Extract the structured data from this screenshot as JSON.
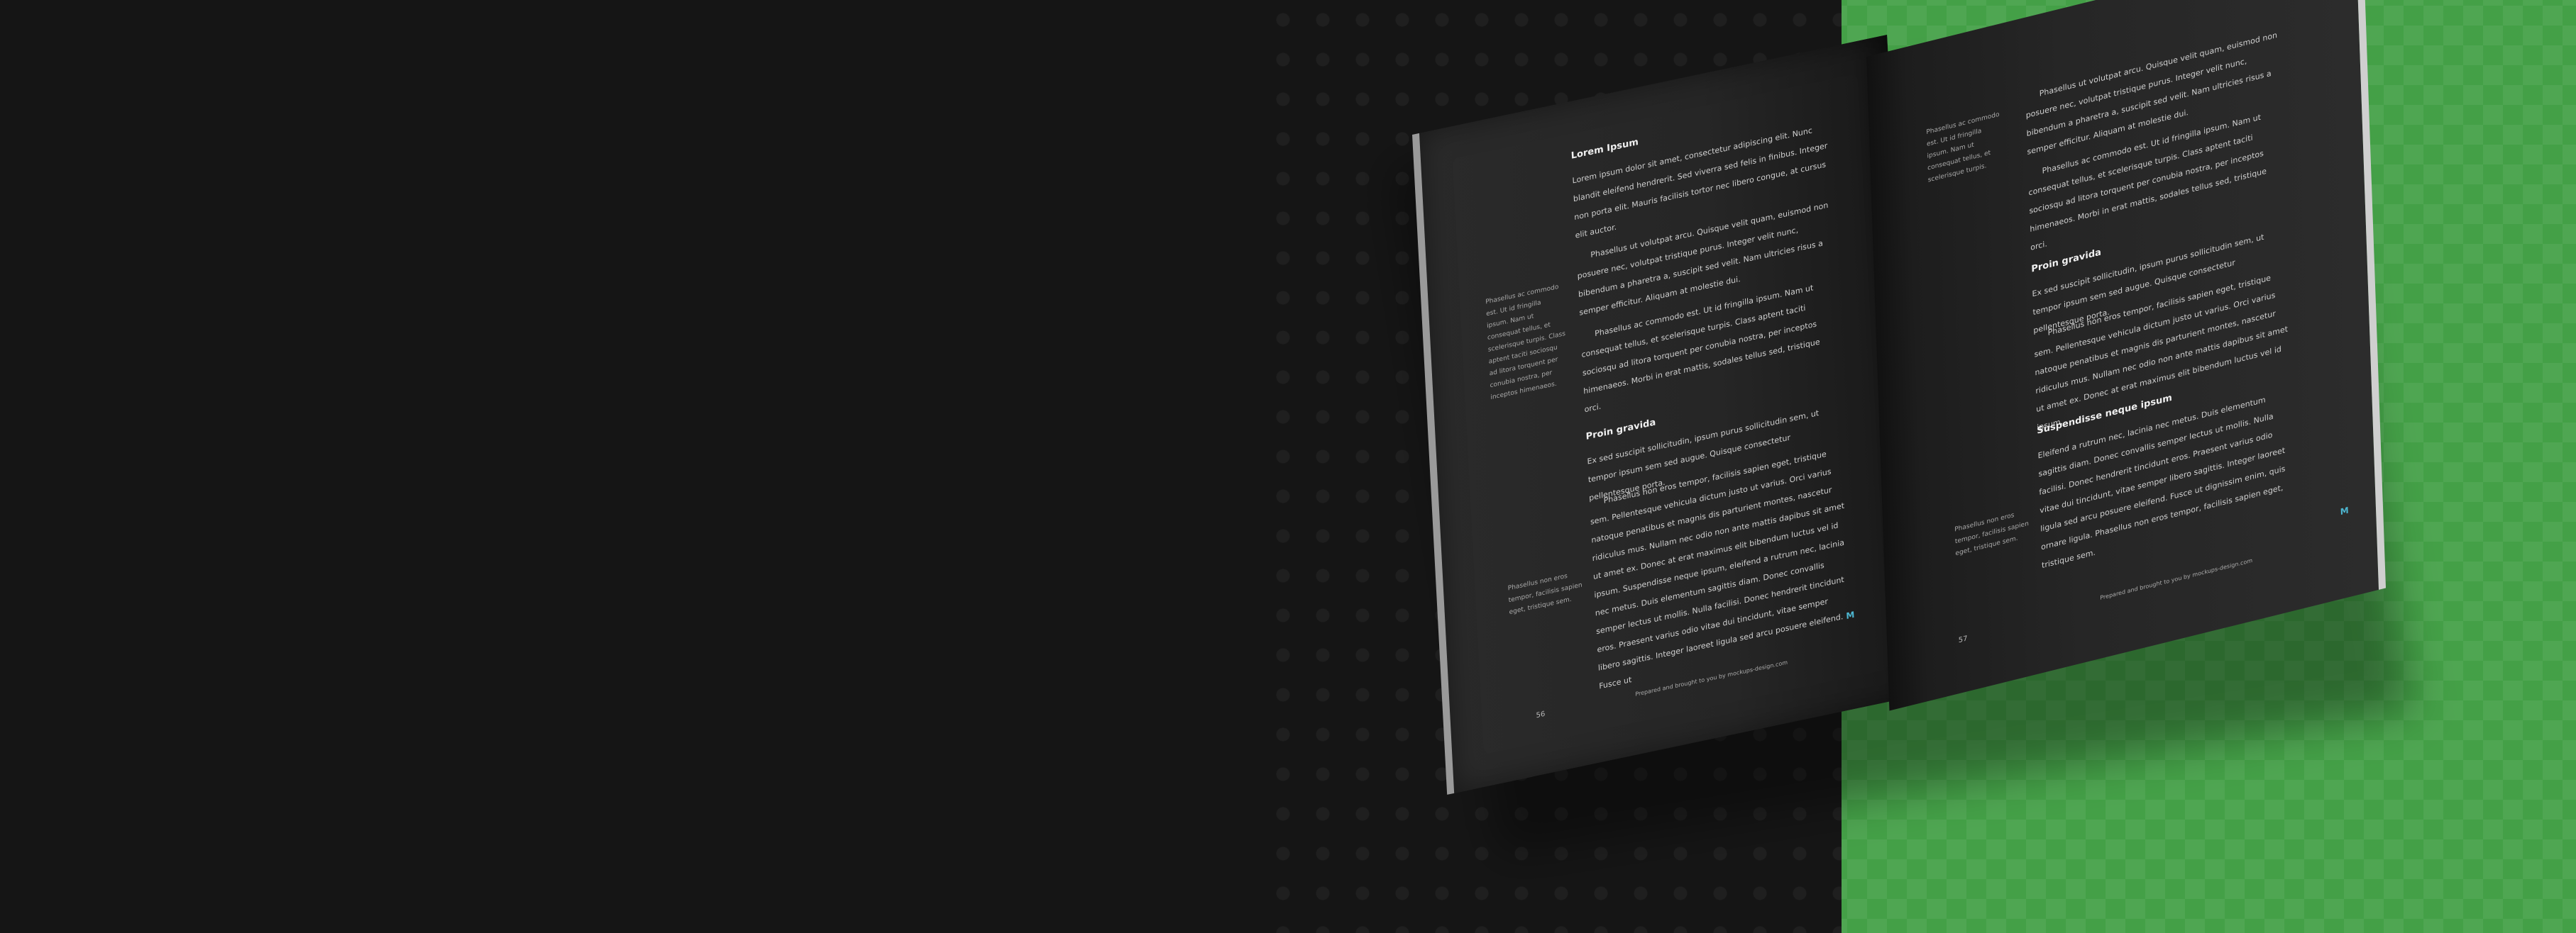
{
  "colors": {
    "dark_bg": "#151515",
    "green_bg": "#44a047",
    "accent": "#4db6d0"
  },
  "left_page": {
    "heading1": "Lorem Ipsum",
    "para1": "Lorem ipsum dolor sit amet, consectetur adipiscing elit. Nunc blandit eleifend hendrerit. Sed viverra sed felis in finibus. Integer non porta elit. Mauris facilisis tortor nec libero congue, at cursus elit auctor.",
    "para2": "Phasellus ut volutpat arcu. Quisque velit quam, euismod non posuere nec, volutpat tristique purus. Integer velit nunc, bibendum a pharetra a, suscipit sed velit. Nam ultricies risus a semper efficitur. Aliquam at molestie dui.",
    "para3": "Phasellus ac commodo est. Ut id fringilla ipsum. Nam ut consequat tellus, et scelerisque turpis. Class aptent taciti sociosqu ad litora torquent per conubia nostra, per inceptos himenaeos. Morbi in erat mattis, sodales tellus sed, tristique orci.",
    "sidenote1": "Phasellus ac commodo est. Ut id fringilla ipsum. Nam ut consequat tellus, et scelerisque turpis. Class aptent taciti sociosqu ad litora torquent per conubia nostra, per inceptos himenaeos.",
    "heading2": "Proin gravida",
    "para4": "Ex sed suscipit sollicitudin, ipsum purus sollicitudin sem, ut tempor ipsum sem sed augue. Quisque consectetur pellentesque porta.",
    "para5": "Phasellus non eros tempor, facilisis sapien eget, tristique sem. Pellentesque vehicula dictum justo ut varius. Orci varius natoque penatibus et magnis dis parturient montes, nascetur ridiculus mus. Nullam nec odio non ante mattis dapibus sit amet ut amet ex. Donec at erat maximus elit bibendum luctus vel id ipsum. Suspendisse neque ipsum, eleifend a rutrum nec, lacinia nec metus. Duis elementum sagittis diam. Donec convallis semper lectus ut mollis. Nulla facilisi. Donec hendrerit tincidunt eros. Praesent varius odio vitae dui tincidunt, vitae semper libero sagittis. Integer laoreet ligula sed arcu posuere eleifend. Fusce ut",
    "sidenote2": "Phasellus non eros tempor, facilisis sapien eget, tristique sem.",
    "page_number": "56",
    "footer": "Prepared and brought to you by mockups-design.com",
    "logo": "M"
  },
  "right_page": {
    "sidenote1": "Phasellus ac commodo est. Ut id fringilla ipsum. Nam ut consequat tellus, et scelerisque turpis.",
    "para1": "Phasellus ut volutpat arcu. Quisque velit quam, euismod non posuere nec, volutpat tristique purus. Integer velit nunc, bibendum a pharetra a, suscipit sed velit. Nam ultricies risus a semper efficitur. Aliquam at molestie dui.",
    "para2": "Phasellus ac commodo est. Ut id fringilla ipsum. Nam ut consequat tellus, et scelerisque turpis. Class aptent taciti sociosqu ad litora torquent per conubia nostra, per inceptos himenaeos. Morbi in erat mattis, sodales tellus sed, tristique orci.",
    "heading1": "Proin gravida",
    "para3": "Ex sed suscipit sollicitudin, ipsum purus sollicitudin sem, ut tempor ipsum sem sed augue. Quisque consectetur pellentesque porta.",
    "para4": "Phasellus non eros tempor, facilisis sapien eget, tristique sem. Pellentesque vehicula dictum justo ut varius. Orci varius natoque penatibus et magnis dis parturient montes, nascetur ridiculus mus. Nullam nec odio non ante mattis dapibus sit amet ut amet ex. Donec at erat maximus elit bibendum luctus vel id ipsum.",
    "heading2": "Suspendisse neque ipsum",
    "para5": "Eleifend a rutrum nec, lacinia nec metus. Duis elementum sagittis diam. Donec convallis semper lectus ut mollis. Nulla facilisi. Donec hendrerit tincidunt eros. Praesent varius odio vitae dui tincidunt, vitae semper libero sagittis. Integer laoreet ligula sed arcu posuere eleifend. Fusce ut dignissim enim, quis ornare ligula. Phasellus non eros tempor, facilisis sapien eget, tristique sem.",
    "sidenote2": "Phasellus non eros tempor, facilisis sapien eget, tristique sem.",
    "page_number": "57",
    "footer": "Prepared and brought to you by mockups-design.com",
    "logo": "M"
  }
}
